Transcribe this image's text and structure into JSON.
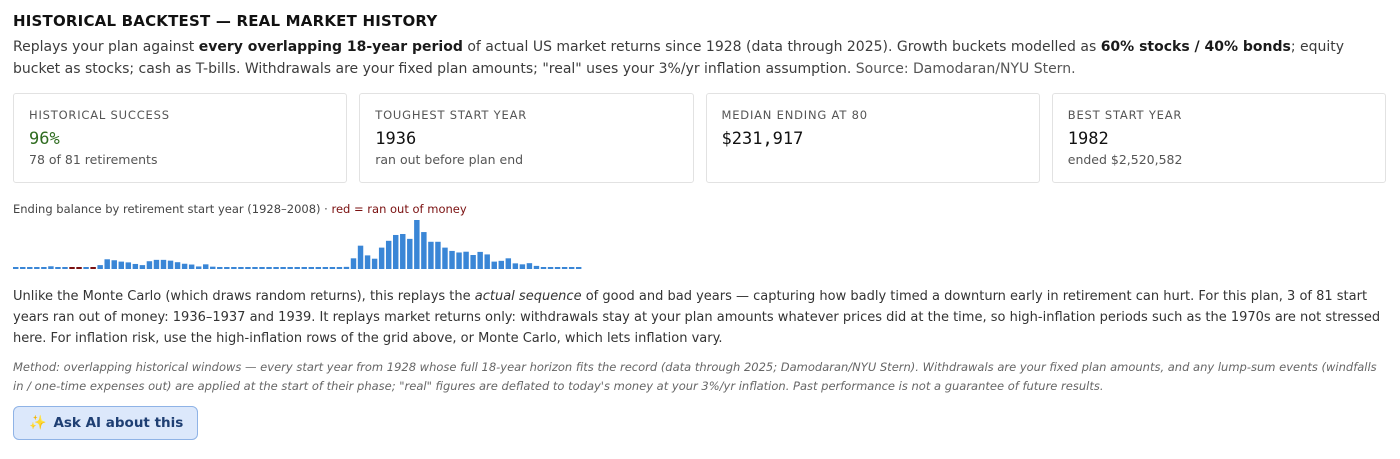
{
  "header": {
    "title": "HISTORICAL BACKTEST — REAL MARKET HISTORY"
  },
  "intro": {
    "p1": "Replays your plan against ",
    "b1": "every overlapping 18-year period",
    "p2": " of actual US market returns since 1928 (data through 2025). Growth buckets modelled as ",
    "b2": "60% stocks / 40% bonds",
    "p3": "; equity bucket as stocks; cash as T-bills. Withdrawals are your fixed plan amounts; \"real\" uses your 3%/yr inflation assumption.",
    "source": "Source: Damodaran/NYU Stern."
  },
  "cards": [
    {
      "label": "HISTORICAL SUCCESS",
      "value": "96%",
      "sub": "78 of 81 retirements"
    },
    {
      "label": "TOUGHEST START YEAR",
      "value": "1936",
      "sub": "ran out before plan end"
    },
    {
      "label": "MEDIAN ENDING AT 80",
      "value": "$231,917",
      "sub": ""
    },
    {
      "label": "BEST START YEAR",
      "value": "1982",
      "sub": "ended $2,520,582"
    }
  ],
  "chart_caption": {
    "main": "Ending balance by retirement start year (1928–2008) · ",
    "red": "red = ran out of money"
  },
  "colors": {
    "bar": "#3a86d6",
    "failed": "#7a1010",
    "good": "#2e6b1f"
  },
  "chart_data": {
    "type": "bar",
    "x": [
      1928,
      1929,
      1930,
      1931,
      1932,
      1933,
      1934,
      1935,
      1936,
      1937,
      1938,
      1939,
      1940,
      1941,
      1942,
      1943,
      1944,
      1945,
      1946,
      1947,
      1948,
      1949,
      1950,
      1951,
      1952,
      1953,
      1954,
      1955,
      1956,
      1957,
      1958,
      1959,
      1960,
      1961,
      1962,
      1963,
      1964,
      1965,
      1966,
      1967,
      1968,
      1969,
      1970,
      1971,
      1972,
      1973,
      1974,
      1975,
      1976,
      1977,
      1978,
      1979,
      1980,
      1981,
      1982,
      1983,
      1984,
      1985,
      1986,
      1987,
      1988,
      1989,
      1990,
      1991,
      1992,
      1993,
      1994,
      1995,
      1996,
      1997,
      1998,
      1999,
      2000,
      2001,
      2002,
      2003,
      2004,
      2005,
      2006,
      2007,
      2008
    ],
    "values": [
      90000,
      90000,
      90000,
      90000,
      90000,
      140000,
      70000,
      70000,
      0,
      0,
      60000,
      0,
      200000,
      500000,
      450000,
      380000,
      340000,
      260000,
      200000,
      400000,
      470000,
      470000,
      430000,
      350000,
      270000,
      230000,
      130000,
      240000,
      120000,
      60000,
      90000,
      60000,
      60000,
      60000,
      60000,
      60000,
      60000,
      60000,
      60000,
      60000,
      60000,
      60000,
      60000,
      80000,
      90000,
      90000,
      90000,
      110000,
      550000,
      1200000,
      700000,
      530000,
      1100000,
      1450000,
      1750000,
      1800000,
      1550000,
      2520582,
      1900000,
      1400000,
      1400000,
      1100000,
      930000,
      850000,
      890000,
      720000,
      880000,
      750000,
      380000,
      420000,
      550000,
      290000,
      240000,
      300000,
      160000,
      80000,
      80000,
      80000,
      80000,
      80000,
      80000
    ],
    "failed_years": [
      1936,
      1937,
      1939
    ],
    "ylim": [
      0,
      2520582
    ]
  },
  "narrative": {
    "p1": "Unlike the Monte Carlo (which draws random returns), this replays the ",
    "em": "actual sequence",
    "p2": " of good and bad years — capturing how badly timed a downturn early in retirement can hurt. For this plan, 3 of 81 start years ran out of money: 1936–1937 and 1939. It replays market returns only: withdrawals stay at your plan amounts whatever prices did at the time, so high-inflation periods such as the 1970s are not stressed here. For inflation risk, use the high-inflation rows of the grid above, or Monte Carlo, which lets inflation vary."
  },
  "method": "Method: overlapping historical windows — every start year from 1928 whose full 18-year horizon fits the record (data through 2025; Damodaran/NYU Stern). Withdrawals are your fixed plan amounts, and any lump-sum events (windfalls in / one-time expenses out) are applied at the start of their phase; \"real\" figures are deflated to today's money at your 3%/yr inflation. Past performance is not a guarantee of future results.",
  "ask_button": {
    "icon": "sparkle-icon",
    "label": "Ask AI about this"
  }
}
